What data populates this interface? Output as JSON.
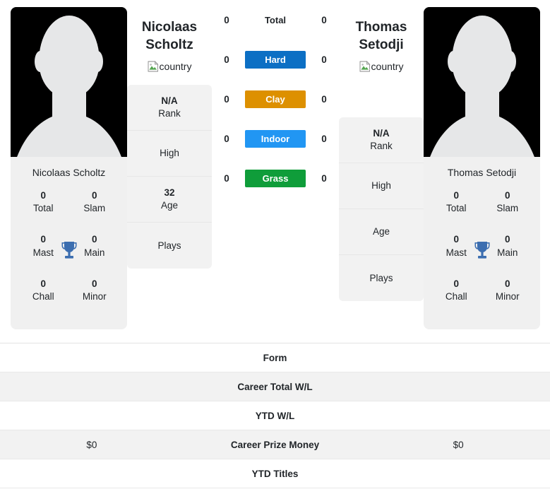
{
  "players": {
    "left": {
      "first_name": "Nicolaas",
      "last_name": "Scholtz",
      "full_name": "Nicolaas Scholtz",
      "country_alt": "country",
      "info": [
        {
          "value": "N/A",
          "label": "Rank"
        },
        {
          "value": "",
          "label": "High"
        },
        {
          "value": "32",
          "label": "Age"
        },
        {
          "value": "",
          "label": "Plays"
        }
      ],
      "titles": [
        {
          "value": "0",
          "label": "Total"
        },
        {
          "value": "0",
          "label": "Slam"
        },
        {
          "value": "0",
          "label": "Mast"
        },
        {
          "value": "0",
          "label": "Main"
        },
        {
          "value": "0",
          "label": "Chall"
        },
        {
          "value": "0",
          "label": "Minor"
        }
      ]
    },
    "right": {
      "first_name": "Thomas",
      "last_name": "Setodji",
      "full_name": "Thomas Setodji",
      "country_alt": "country",
      "info": [
        {
          "value": "N/A",
          "label": "Rank"
        },
        {
          "value": "",
          "label": "High"
        },
        {
          "value": "",
          "label": "Age"
        },
        {
          "value": "",
          "label": "Plays"
        }
      ],
      "titles": [
        {
          "value": "0",
          "label": "Total"
        },
        {
          "value": "0",
          "label": "Slam"
        },
        {
          "value": "0",
          "label": "Mast"
        },
        {
          "value": "0",
          "label": "Main"
        },
        {
          "value": "0",
          "label": "Chall"
        },
        {
          "value": "0",
          "label": "Minor"
        }
      ]
    }
  },
  "surfaces": [
    {
      "label": "Total",
      "left": "0",
      "right": "0",
      "color": "",
      "plain": true
    },
    {
      "label": "Hard",
      "left": "0",
      "right": "0",
      "color": "#0c6fc4",
      "plain": false
    },
    {
      "label": "Clay",
      "left": "0",
      "right": "0",
      "color": "#dd9000",
      "plain": false
    },
    {
      "label": "Indoor",
      "left": "0",
      "right": "0",
      "color": "#2196f3",
      "plain": false
    },
    {
      "label": "Grass",
      "left": "0",
      "right": "0",
      "color": "#0f9d3a",
      "plain": false
    }
  ],
  "stat_rows": [
    {
      "left": "",
      "label": "Form",
      "right": ""
    },
    {
      "left": "",
      "label": "Career Total W/L",
      "right": ""
    },
    {
      "left": "",
      "label": "YTD W/L",
      "right": ""
    },
    {
      "left": "$0",
      "label": "Career Prize Money",
      "right": "$0"
    },
    {
      "left": "",
      "label": "YTD Titles",
      "right": ""
    }
  ],
  "colors": {
    "hard": "#0c6fc4",
    "clay": "#dd9000",
    "indoor": "#2196f3",
    "grass": "#0f9d3a",
    "card_bg": "#f2f2f2",
    "trophy": "#3c6eb0"
  }
}
